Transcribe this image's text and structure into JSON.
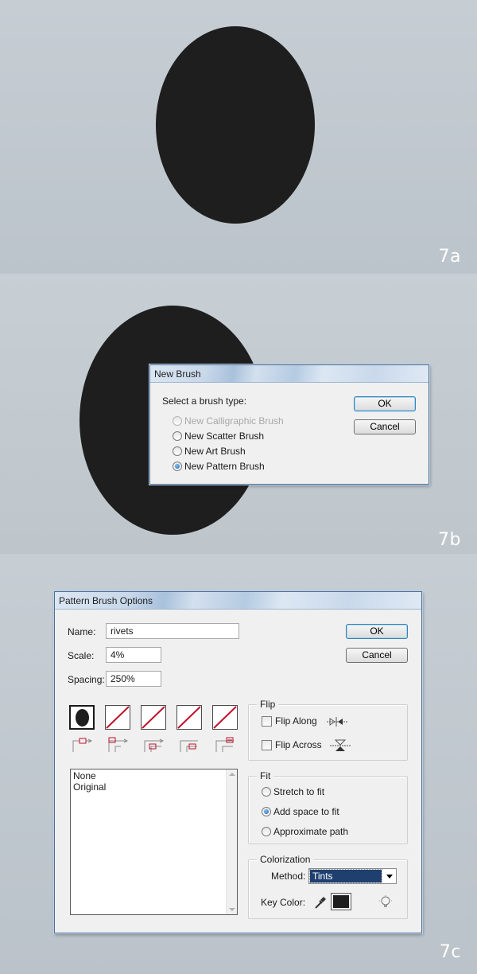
{
  "panels": {
    "a": {
      "label": "7a"
    },
    "b": {
      "label": "7b"
    },
    "c": {
      "label": "7c"
    }
  },
  "new_brush": {
    "title": "New Brush",
    "prompt": "Select a brush type:",
    "options": [
      {
        "label": "New Calligraphic Brush",
        "state": "disabled"
      },
      {
        "label": "New Scatter Brush",
        "state": "unchecked"
      },
      {
        "label": "New Art Brush",
        "state": "unchecked"
      },
      {
        "label": "New Pattern Brush",
        "state": "checked"
      }
    ],
    "ok_label": "OK",
    "cancel_label": "Cancel"
  },
  "pattern_brush": {
    "title": "Pattern Brush Options",
    "name_label": "Name:",
    "name_value": "rivets",
    "scale_label": "Scale:",
    "scale_value": "4%",
    "spacing_label": "Spacing:",
    "spacing_value": "250%",
    "ok_label": "OK",
    "cancel_label": "Cancel",
    "tiles": [
      "side-tile",
      "outer-corner-tile",
      "inner-corner-tile",
      "start-tile",
      "end-tile"
    ],
    "pattern_list": [
      "None",
      "Original"
    ],
    "flip": {
      "title": "Flip",
      "along_label": "Flip Along",
      "across_label": "Flip Across",
      "along_checked": false,
      "across_checked": false
    },
    "fit": {
      "title": "Fit",
      "options": [
        {
          "label": "Stretch to fit",
          "checked": false
        },
        {
          "label": "Add space to fit",
          "checked": true
        },
        {
          "label": "Approximate path",
          "checked": false
        }
      ]
    },
    "colorization": {
      "title": "Colorization",
      "method_label": "Method:",
      "method_value": "Tints",
      "key_color_label": "Key Color:",
      "key_color": "#1e1e1e"
    }
  },
  "colors": {
    "shape_fill": "#1e1e1e",
    "tile_slash": "#c0102a",
    "selection": "#1f3f6e"
  }
}
